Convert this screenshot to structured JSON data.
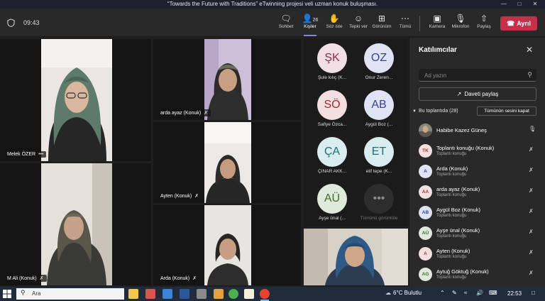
{
  "window": {
    "title": "“Towards the Future with Traditions” eTwinning projesi veli uzman konuk buluşması."
  },
  "toolbar": {
    "elapsed": "09:43",
    "people_count": "26",
    "buttons": {
      "chat": "Sohbet",
      "people": "Kişiler",
      "raise_hand": "Söz iste",
      "react": "Tepki ver",
      "view": "Görünüm",
      "more": "Tümü",
      "camera": "Kamera",
      "mic": "Mikrofon",
      "share": "Paylaş"
    },
    "leave": "Ayrıl"
  },
  "video_tiles": [
    {
      "name": "Melek ÖZER",
      "extra": "•••"
    },
    {
      "name": "arda ayaz (Konuk)"
    },
    {
      "name": "Ayten (Konuk)"
    },
    {
      "name": "M Ali (Konuk)"
    },
    {
      "name": "Arda (Konuk)"
    }
  ],
  "avatar_grid": [
    {
      "initials": "ŞK",
      "name": "Şule kılıç (K..."
    },
    {
      "initials": "OZ",
      "name": "Onur Zeren..."
    },
    {
      "initials": "SÖ",
      "name": "Safiye Özca..."
    },
    {
      "initials": "AB",
      "name": "Aygül Boz (..."
    },
    {
      "initials": "ÇA",
      "name": "ÇINAR AKK..."
    },
    {
      "initials": "ET",
      "name": "elif tepe (K..."
    },
    {
      "initials": "AÜ",
      "name": "Ayşe ünal (..."
    },
    {
      "initials": "•••",
      "name": "Tümünü görüntüle"
    }
  ],
  "panel": {
    "title": "Katılımcılar",
    "search_placeholder": "Ad yazın",
    "invite": "Daveti paylaş",
    "section": "Bu toplantıda (28)",
    "mute_all": "Tümünün sesini kapat",
    "participants": [
      {
        "initials": "",
        "name": "Habibe Kazez Güneş",
        "role": ""
      },
      {
        "initials": "TK",
        "name": "Toplantı konuğu (Konuk)",
        "role": "Toplantı konuğu"
      },
      {
        "initials": "A",
        "name": "Arda (Konuk)",
        "role": "Toplantı konuğu"
      },
      {
        "initials": "AA",
        "name": "arda ayaz (Konuk)",
        "role": "Toplantı konuğu"
      },
      {
        "initials": "AB",
        "name": "Aygül Boz (Konuk)",
        "role": "Toplantı konuğu"
      },
      {
        "initials": "AÜ",
        "name": "Ayşe ünal (Konuk)",
        "role": "Toplantı konuğu"
      },
      {
        "initials": "A",
        "name": "Ayten (Konuk)",
        "role": "Toplantı konuğu"
      },
      {
        "initials": "AG",
        "name": "Aytuğ Göktuğ (Konuk)",
        "role": "Toplantı konuğu"
      }
    ]
  },
  "taskbar": {
    "search": "Ara",
    "weather": "6°C  Bulutlu",
    "time": "22:53"
  },
  "colors": {
    "leave": "#c4314b",
    "accent": "#7f85f5",
    "panel_bg": "#292929"
  }
}
